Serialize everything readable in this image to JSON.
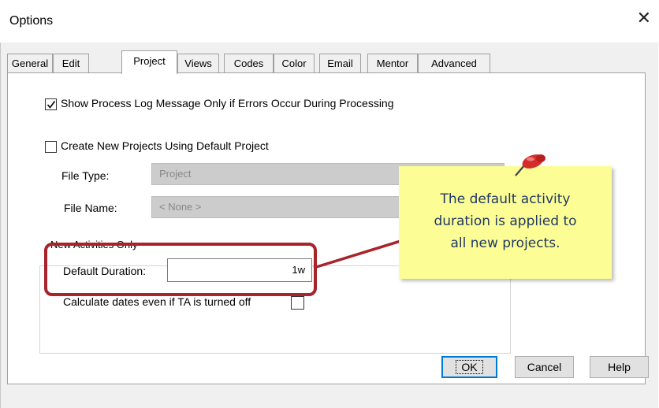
{
  "window": {
    "title": "Options",
    "close_glyph": "✕"
  },
  "tabs": [
    "General",
    "Edit",
    "Project",
    "Views",
    "Codes",
    "Color",
    "Email",
    "Mentor",
    "Advanced"
  ],
  "active_tab": "Project",
  "options": {
    "show_log": {
      "label": "Show Process Log Message Only if Errors Occur During Processing",
      "checked": true
    },
    "create_default": {
      "label": "Create New Projects Using Default Project",
      "checked": false
    },
    "file_type": {
      "label": "File Type:",
      "value": "Project"
    },
    "file_name": {
      "label": "File Name:",
      "value": "< None >"
    }
  },
  "new_activities": {
    "group_label": "New Activities Only",
    "default_duration": {
      "label": "Default Duration:",
      "value": "1w"
    },
    "calc_dates": {
      "label": "Calculate dates even if TA is turned off",
      "checked": false
    }
  },
  "callout": {
    "lines": [
      "The default activity",
      "duration is applied to",
      "all new projects."
    ],
    "note_color": "#fdfd96",
    "text_color": "#1f3864",
    "highlight_color": "#a8232a",
    "pin_icon": "pushpin-icon"
  },
  "buttons": {
    "ok": "OK",
    "cancel": "Cancel",
    "help": "Help"
  }
}
